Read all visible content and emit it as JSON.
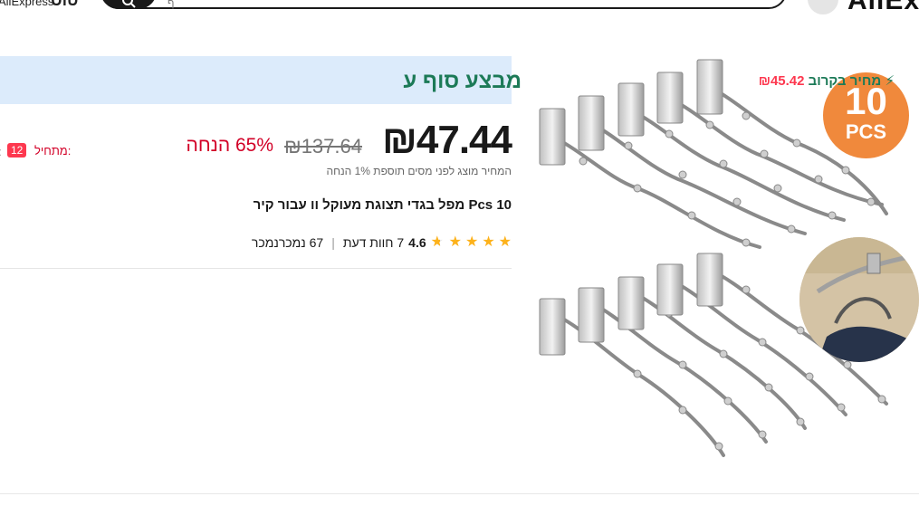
{
  "header": {
    "brand_small": "AliExpress",
    "brand_glyph": "טוס",
    "search_placeholder": "ף",
    "logo_text": "AliEx"
  },
  "deal": {
    "title": "מבצע סוף ע",
    "soon_label": "מחיר בקרוב",
    "soon_price": "₪45.42"
  },
  "price": {
    "current": "₪47.44",
    "original": "₪137.64",
    "discount": "65% הנחה",
    "tax_note": "המחיר מוצג לפני מסים תוספת 1% הנחה"
  },
  "starts": {
    "label": "מתחיל:",
    "value": "12",
    "colon": ":"
  },
  "product": {
    "title": "10 Pcs מפל בגדי תצוגת מעוקל וו עבור קיר",
    "badge_number": "10",
    "badge_text": "PCS"
  },
  "rating": {
    "value": "4.6",
    "stars": 4.6,
    "reviews": "7 חוות דעת",
    "sold": "67 נמכרנמכר"
  },
  "colors": {
    "accent_red": "#fd384f",
    "discount_red": "#d20027",
    "deal_green": "#1c7a57",
    "banner_blue": "#dcebfb",
    "badge_orange": "#f0893c",
    "star": "#fdb21b"
  },
  "icons": [
    "search-icon",
    "user-icon",
    "bolt-icon",
    "star-icon"
  ]
}
